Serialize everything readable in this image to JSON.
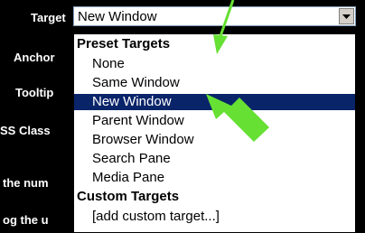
{
  "form": {
    "labels": [
      "Target",
      "Anchor",
      "Tooltip",
      "SS Class",
      "the num",
      "og the u"
    ]
  },
  "combo": {
    "value": "New Window"
  },
  "dropdown": {
    "items": [
      {
        "label": "Preset Targets",
        "type": "group"
      },
      {
        "label": "None",
        "type": "option"
      },
      {
        "label": "Same Window",
        "type": "option"
      },
      {
        "label": "New Window",
        "type": "option",
        "selected": true
      },
      {
        "label": "Parent Window",
        "type": "option"
      },
      {
        "label": "Browser Window",
        "type": "option"
      },
      {
        "label": "Search Pane",
        "type": "option"
      },
      {
        "label": "Media Pane",
        "type": "option"
      },
      {
        "label": "Custom Targets",
        "type": "group"
      },
      {
        "label": "[add custom target...]",
        "type": "option"
      }
    ]
  },
  "colors": {
    "background": "#000000",
    "selection": "#0a246a",
    "annotation_arrow": "#66e033"
  },
  "icons": {
    "dropdown": "chevron-down-icon",
    "annotation": "arrow-annotation-icon"
  }
}
